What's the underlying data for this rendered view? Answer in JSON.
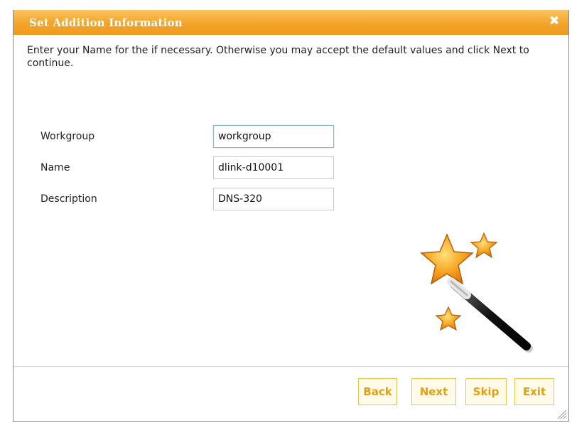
{
  "dialog": {
    "title": "Set Addition Information",
    "close_symbol": "✖",
    "intro_text": "Enter your Name for the if necessary. Otherwise you may accept the default values and click Next to continue."
  },
  "form": {
    "workgroup": {
      "label": "Workgroup",
      "value": "workgroup"
    },
    "name": {
      "label": "Name",
      "value": "dlink-d10001"
    },
    "description": {
      "label": "Description",
      "value": "DNS-320"
    }
  },
  "buttons": {
    "back": "Back",
    "next": "Next",
    "skip": "Skip",
    "exit": "Exit"
  },
  "icons": {
    "close": "close-icon",
    "wizard": "magic-wand-stars-icon",
    "resize": "resize-grip-icon"
  },
  "colors": {
    "titlebar": "#f4a42a",
    "button_text": "#e3a10f",
    "button_border": "#f0c24e",
    "star": "#f39c12"
  }
}
